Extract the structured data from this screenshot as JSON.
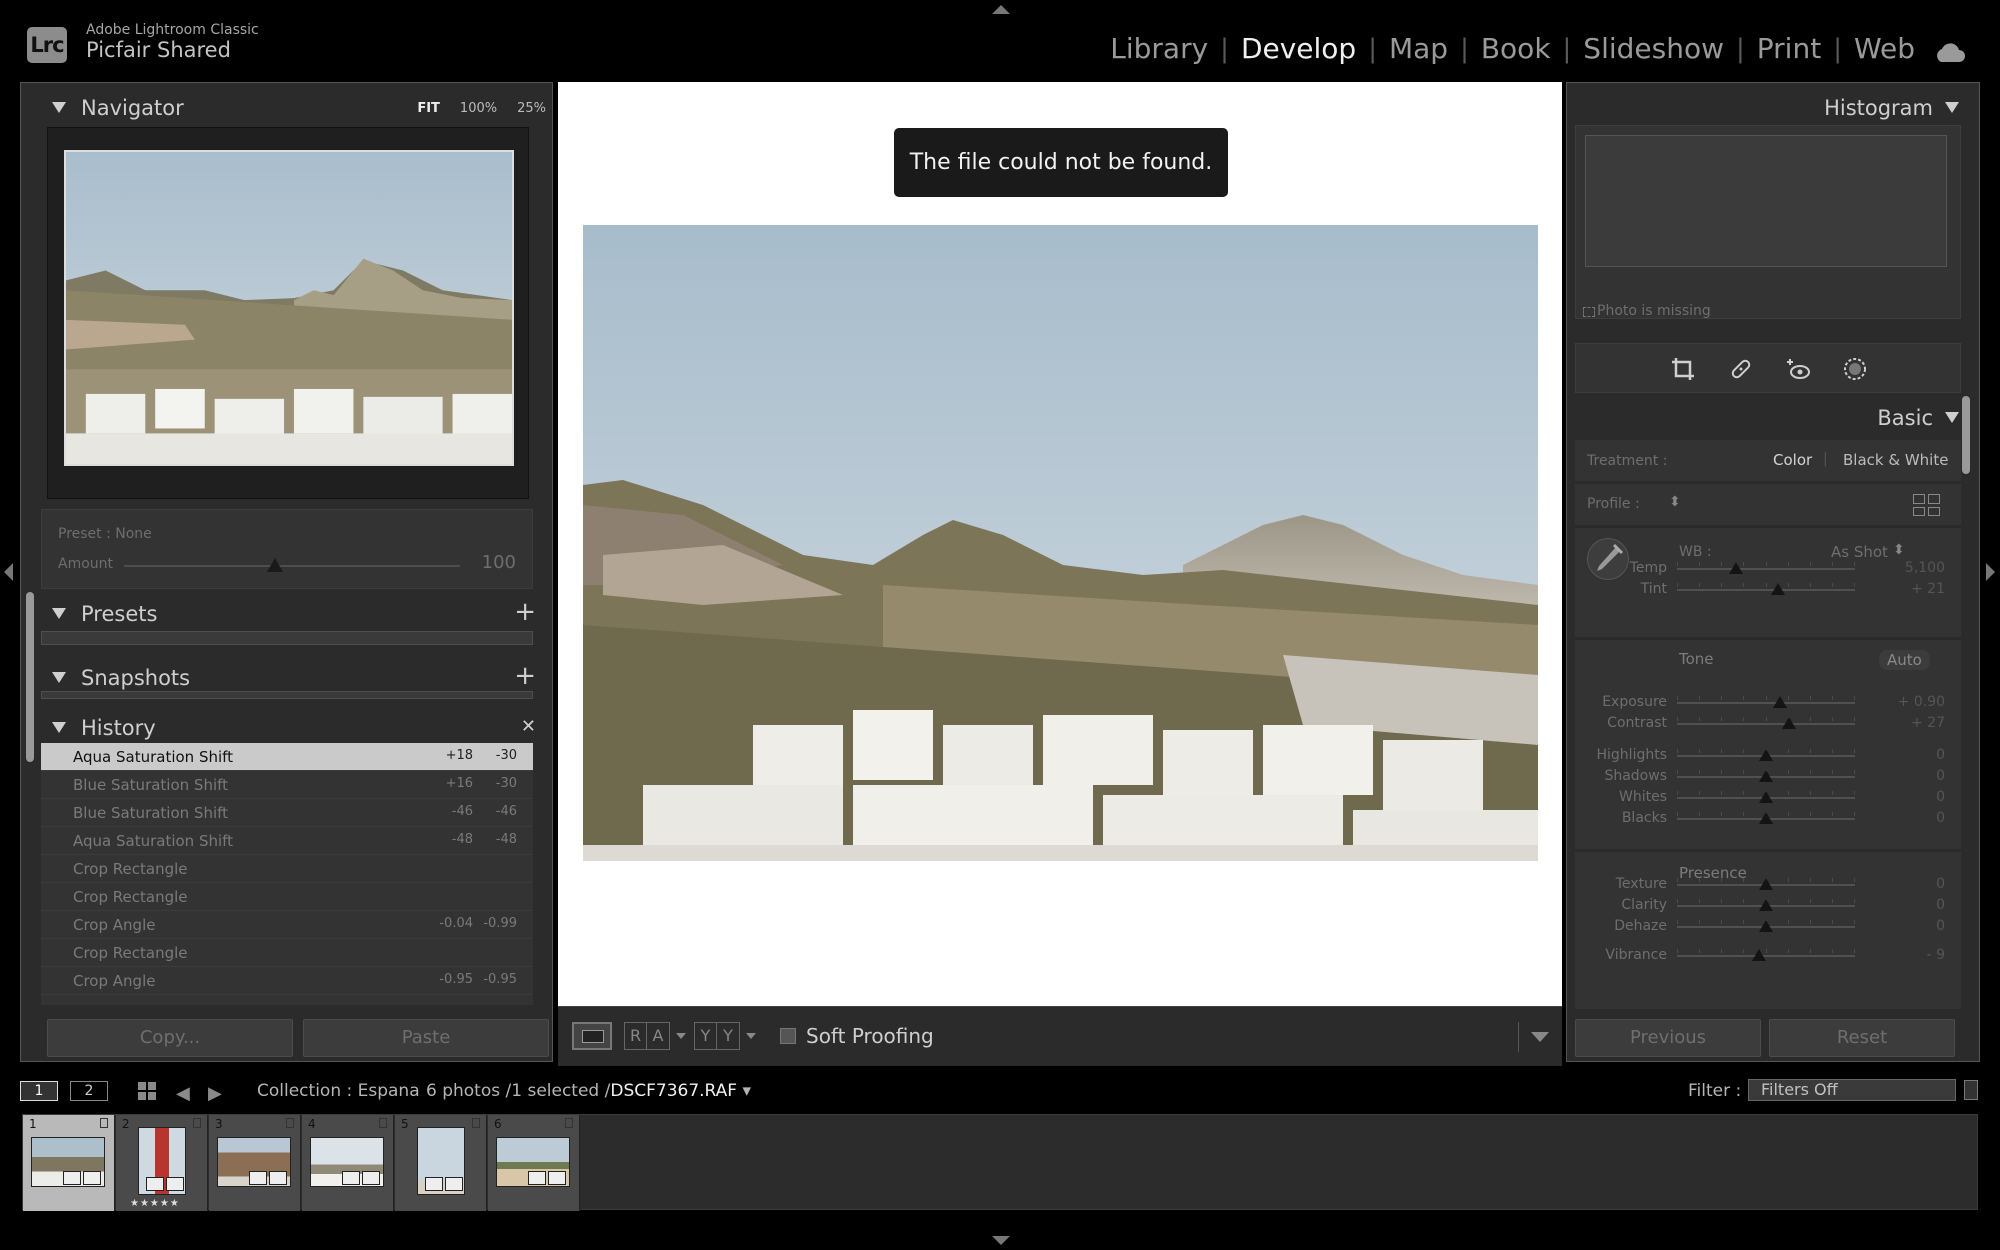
{
  "app": {
    "name": "Adobe Lightroom Classic",
    "logo": "Lrc",
    "catalog": "Picfair Shared"
  },
  "modules": [
    "Library",
    "Develop",
    "Map",
    "Book",
    "Slideshow",
    "Print",
    "Web"
  ],
  "active_module": "Develop",
  "navigator": {
    "title": "Navigator",
    "zoom": [
      "FIT",
      "100%",
      "25%"
    ],
    "preset_label": "Preset : None",
    "amount_label": "Amount",
    "amount_value": "100",
    "amount_level": 0.45
  },
  "panels": {
    "presets": "Presets",
    "snapshots": "Snapshots",
    "history": "History"
  },
  "history": [
    {
      "name": "Aqua Saturation Shift",
      "v1": "+18",
      "v2": "-30",
      "selected": true
    },
    {
      "name": "Blue Saturation Shift",
      "v1": "+16",
      "v2": "-30"
    },
    {
      "name": "Blue Saturation Shift",
      "v1": "-46",
      "v2": "-46"
    },
    {
      "name": "Aqua Saturation Shift",
      "v1": "-48",
      "v2": "-48"
    },
    {
      "name": "Crop Rectangle",
      "v1": "",
      "v2": ""
    },
    {
      "name": "Crop Rectangle",
      "v1": "",
      "v2": ""
    },
    {
      "name": "Crop Angle",
      "v1": "-0.04",
      "v2": "-0.99"
    },
    {
      "name": "Crop Rectangle",
      "v1": "",
      "v2": ""
    },
    {
      "name": "Crop Angle",
      "v1": "-0.95",
      "v2": "-0.95"
    }
  ],
  "left_buttons": {
    "copy": "Copy...",
    "paste": "Paste"
  },
  "toast": "The file could not be found.",
  "toolbar": {
    "soft_proofing": "Soft Proofing",
    "ra": [
      "R",
      "A"
    ],
    "yy": [
      "Y",
      "Y"
    ]
  },
  "right": {
    "histogram_title": "Histogram",
    "photo_missing": "Photo is missing",
    "basic_title": "Basic",
    "treatment_label": "Treatment :",
    "treatment_color": "Color",
    "treatment_bw": "Black & White",
    "profile_label": "Profile :",
    "wb_label": "WB :",
    "wb_value": "As Shot",
    "tone_label": "Tone",
    "auto_label": "Auto",
    "presence_label": "Presence",
    "sliders": [
      {
        "name": "Temp",
        "value": "5,100",
        "pos": 0.33
      },
      {
        "name": "Tint",
        "value": "+ 21",
        "pos": 0.57
      },
      {
        "name": "Exposure",
        "value": "+ 0.90",
        "pos": 0.58
      },
      {
        "name": "Contrast",
        "value": "+ 27",
        "pos": 0.63
      },
      {
        "name": "Highlights",
        "value": "0",
        "pos": 0.5
      },
      {
        "name": "Shadows",
        "value": "0",
        "pos": 0.5
      },
      {
        "name": "Whites",
        "value": "0",
        "pos": 0.5
      },
      {
        "name": "Blacks",
        "value": "0",
        "pos": 0.5
      },
      {
        "name": "Texture",
        "value": "0",
        "pos": 0.5
      },
      {
        "name": "Clarity",
        "value": "0",
        "pos": 0.5
      },
      {
        "name": "Dehaze",
        "value": "0",
        "pos": 0.5
      },
      {
        "name": "Vibrance",
        "value": "- 9",
        "pos": 0.46
      }
    ],
    "buttons": {
      "previous": "Previous",
      "reset": "Reset"
    }
  },
  "filmstrip": {
    "views": [
      "1",
      "2"
    ],
    "collection": "Collection : Espana",
    "count": "6 photos /1 selected /",
    "filename": "DSCF7367.RAF",
    "filter_label": "Filter :",
    "filter_value": "Filters Off",
    "cells": [
      {
        "idx": "1",
        "kind": "landscape",
        "selected": true
      },
      {
        "idx": "2",
        "kind": "tower",
        "stars": "★★★★★"
      },
      {
        "idx": "3",
        "kind": "rock"
      },
      {
        "idx": "4",
        "kind": "landscape-bright"
      },
      {
        "idx": "5",
        "kind": "portrait-sky"
      },
      {
        "idx": "6",
        "kind": "palm"
      }
    ]
  }
}
